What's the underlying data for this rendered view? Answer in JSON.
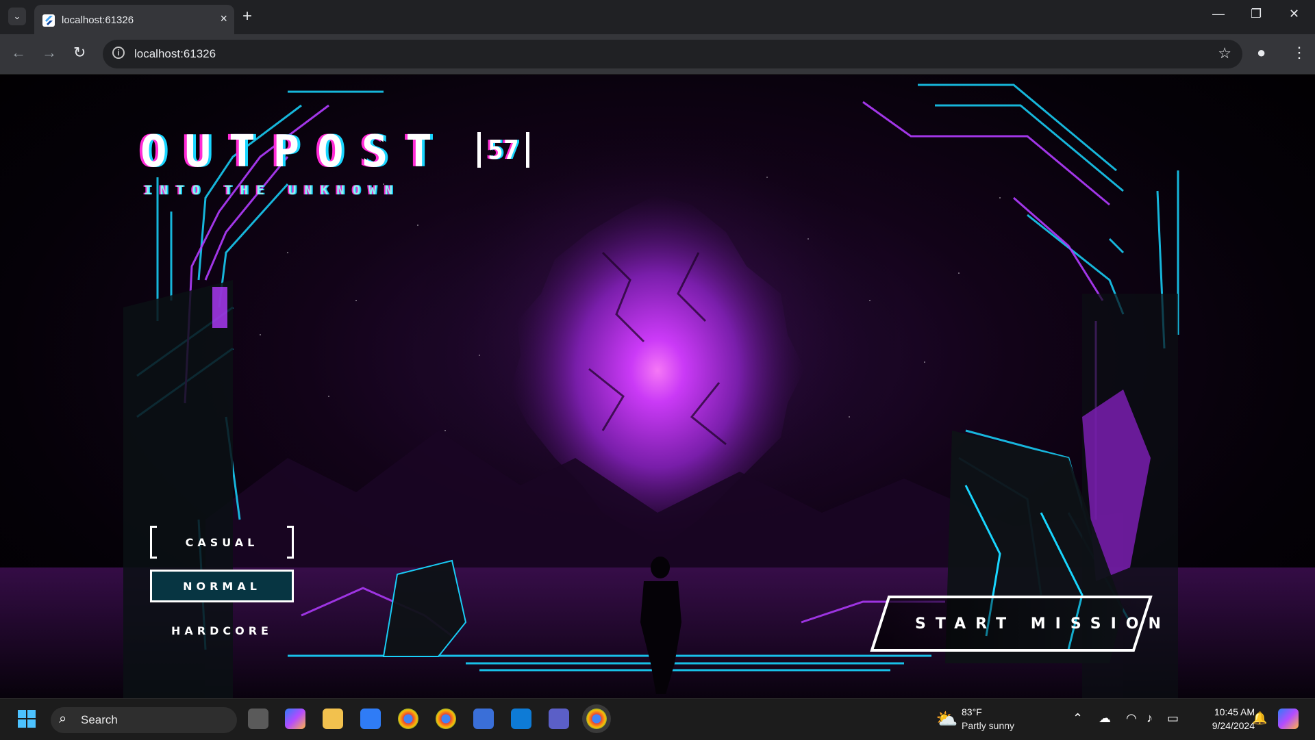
{
  "browser": {
    "tab_title": "localhost:61326",
    "url": "localhost:61326",
    "new_tab_label": "+",
    "tab_close_label": "×"
  },
  "game": {
    "title": "OUTPOST",
    "title_number": "57",
    "subtitle": "INTO THE UNKNOWN",
    "difficulty_options": [
      "CASUAL",
      "NORMAL",
      "HARDCORE"
    ],
    "selected_difficulty": "NORMAL",
    "start_button": "START MISSION"
  },
  "taskbar": {
    "search_label": "Search",
    "weather_temp": "83°F",
    "weather_desc": "Partly sunny",
    "time": "10:45 AM",
    "date": "9/24/2024"
  },
  "colors": {
    "accent_cyan": "#19d6ff",
    "accent_magenta": "#b23cff",
    "selected_fill": "#073542"
  }
}
